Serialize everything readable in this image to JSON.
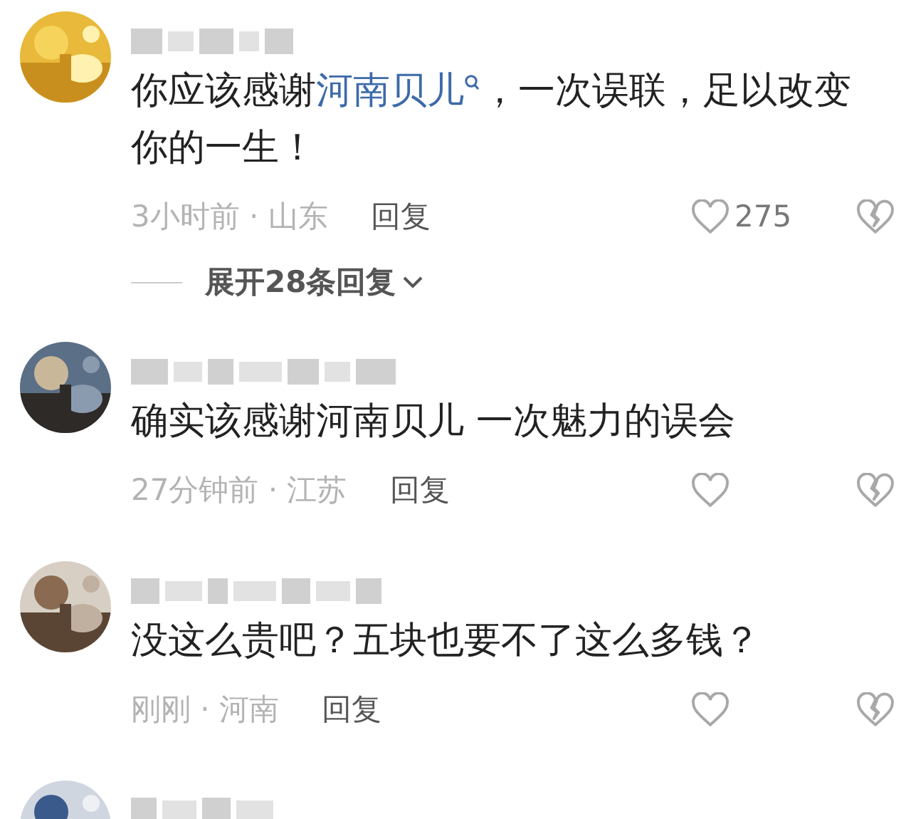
{
  "comments": [
    {
      "kind": "full",
      "text": [
        {
          "kind": "plain",
          "text": "你应该感谢"
        },
        {
          "kind": "link",
          "text": "河南贝儿"
        },
        {
          "kind": "plain",
          "text": "，一次误联，足以改变你的一生！"
        }
      ],
      "meta": "3小时前 · 山东",
      "reply": "回复",
      "likes": "275",
      "expand": "展开28条回复"
    },
    {
      "kind": "full",
      "text": [
        {
          "kind": "plain",
          "text": "确实该感谢河南贝儿 一次魅力的误会"
        }
      ],
      "meta": "27分钟前 · 江苏",
      "reply": "回复"
    },
    {
      "kind": "full",
      "text": [
        {
          "kind": "plain",
          "text": "没这么贵吧？五块也要不了这么多钱？"
        }
      ],
      "meta": "刚刚 · 河南",
      "reply": "回复"
    },
    {
      "kind": "cut"
    }
  ]
}
